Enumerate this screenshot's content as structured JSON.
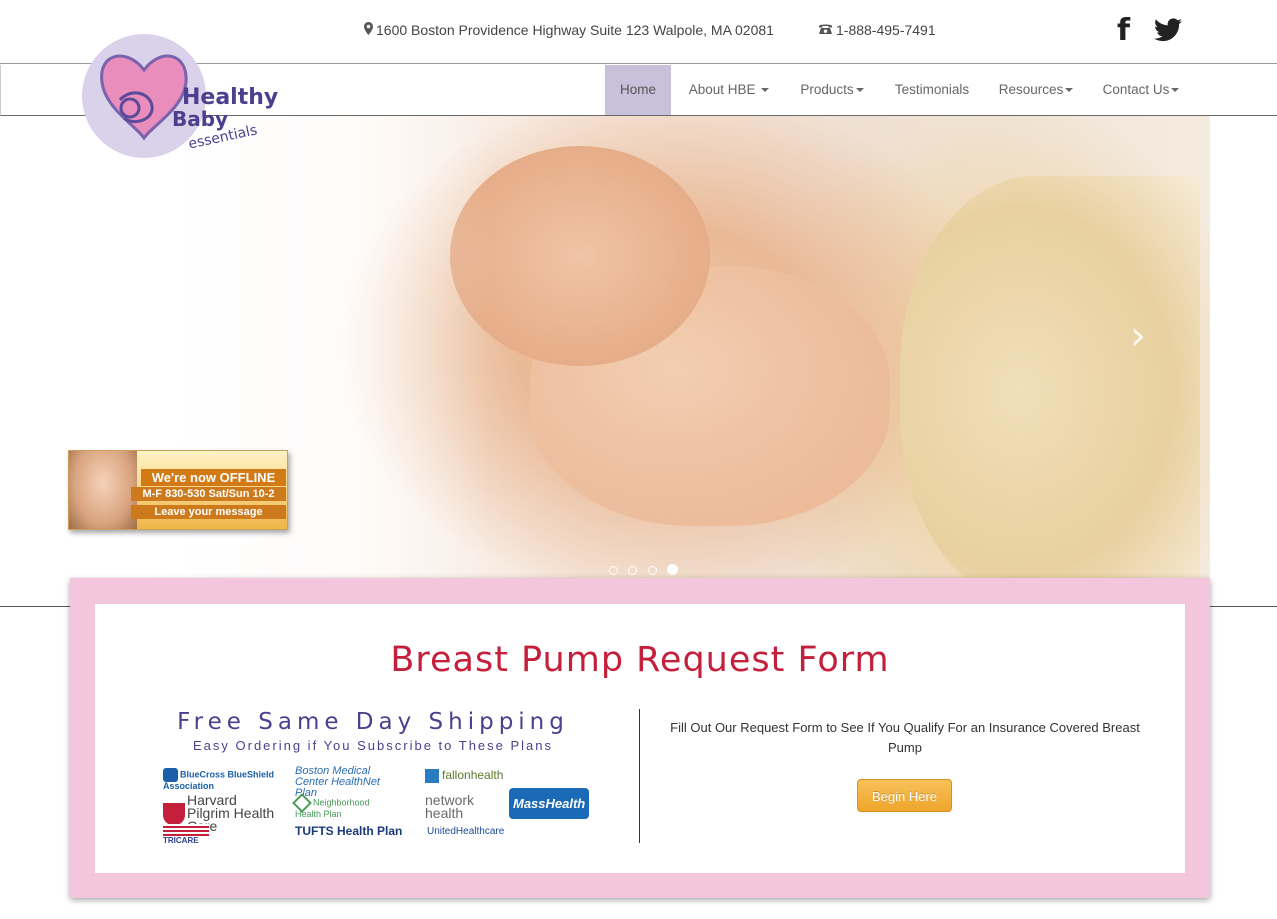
{
  "header": {
    "address": "1600 Boston Providence Highway Suite 123 Walpole, MA 02081",
    "phone": "1-888-495-7491",
    "social": [
      {
        "name": "facebook-icon",
        "glyph": "f"
      },
      {
        "name": "twitter-icon"
      }
    ]
  },
  "logo": {
    "line1": "Healthy",
    "line2": "Baby",
    "line3": "essentials"
  },
  "nav": {
    "items": [
      {
        "label": "Home",
        "active": true,
        "dropdown": false
      },
      {
        "label": "About HBE",
        "active": false,
        "dropdown": true
      },
      {
        "label": "Products",
        "active": false,
        "dropdown": true
      },
      {
        "label": "Testimonials",
        "active": false,
        "dropdown": false
      },
      {
        "label": "Resources",
        "active": false,
        "dropdown": true
      },
      {
        "label": "Contact Us",
        "active": false,
        "dropdown": true
      }
    ]
  },
  "hero": {
    "prev_glyph": "‹",
    "next_glyph": "›",
    "slide_count": 4,
    "active_slide": 4
  },
  "offline_badge": {
    "line1": "We're now OFFLINE",
    "line2": "M-F 830-530 Sat/Sun 10-2",
    "line3": "Leave your message"
  },
  "main": {
    "title": "Breast Pump Request Form",
    "shipping_title": "Free Same Day Shipping",
    "shipping_subtitle": "Easy Ordering if You Subscribe to These Plans",
    "request_text": "Fill Out Our Request Form to See If You Qualify For an Insurance Covered Breast Pump",
    "begin_button": "Begin Here"
  },
  "insurance_logos": [
    "BlueCross BlueShield Association",
    "Harvard Pilgrim Health Care",
    "TRICARE",
    "Boston Medical Center HealthNet Plan",
    "Neighborhood Health Plan",
    "TUFTS Health Plan",
    "fallonhealth",
    "network health",
    "UnitedHealthcare",
    "MassHealth"
  ],
  "colors": {
    "nav_active_bg": "#c9c1dc",
    "title_red": "#c4203c",
    "shipping_purple": "#4d3f8e",
    "pink_frame": "#f3c6de",
    "button_orange": "#eea52b"
  }
}
